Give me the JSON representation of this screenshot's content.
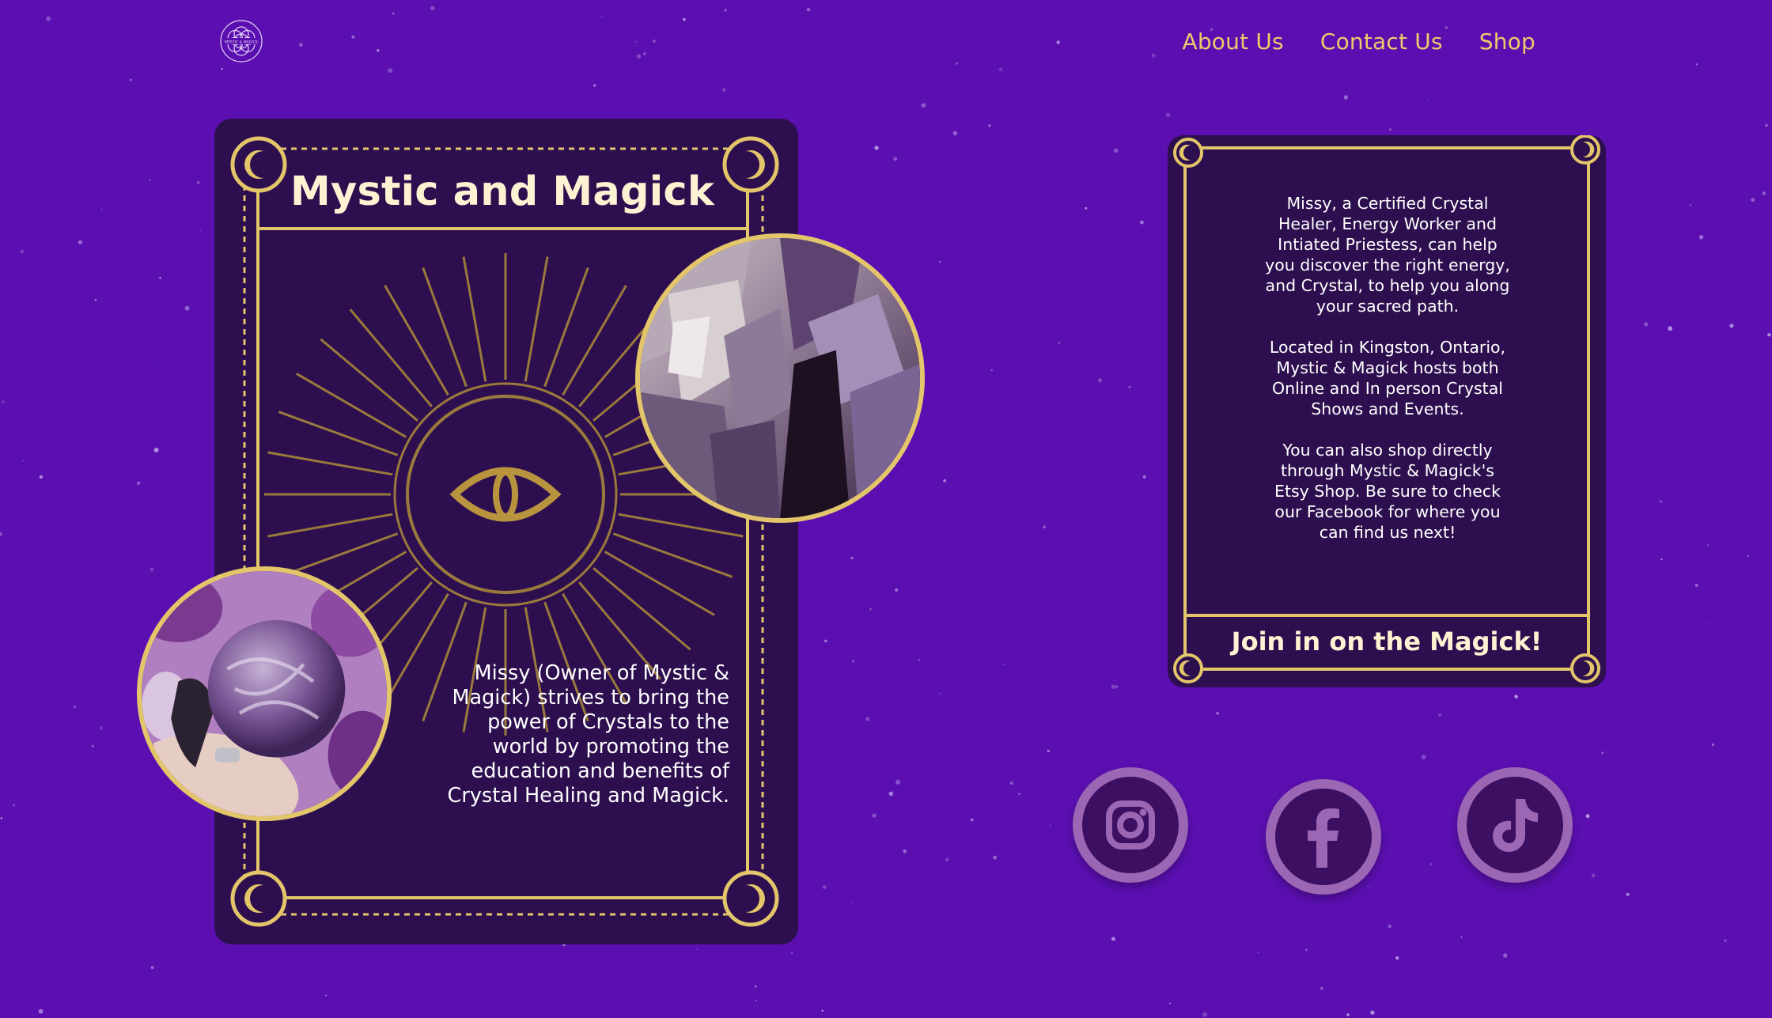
{
  "nav": {
    "logo_text": "MYSTIC & MAGICK",
    "about_label": "About Us",
    "contact_label": "Contact Us",
    "shop_label": "Shop"
  },
  "left_card": {
    "title": "Mystic and Magick",
    "mission_text": "Missy (Owner of Mystic & Magick) strives to bring the power of Crystals to the world by promoting the education and benefits of Crystal Healing and Magick."
  },
  "right_card": {
    "paragraph_1": "Missy, a Certified Crystal Healer, Energy Worker and Intiated Priestess, can help you discover the right energy, and Crystal, to help you along your sacred path.",
    "paragraph_2": "Located in Kingston, Ontario, Mystic & Magick hosts both Online and In person Crystal Shows and Events.",
    "paragraph_3": "You can also shop directly through Mystic & Magick's Etsy Shop. Be sure to check our Facebook for where you can find us next!",
    "join_label": "Join in on the Magick!"
  },
  "social": {
    "icons": [
      "instagram-icon",
      "facebook-icon",
      "tiktok-icon"
    ]
  },
  "colors": {
    "background": "#5b0fb0",
    "card": "#2d0f4f",
    "gold": "#e3c66a",
    "nav_text": "#f2c86c",
    "title_text": "#fdf3d3"
  }
}
